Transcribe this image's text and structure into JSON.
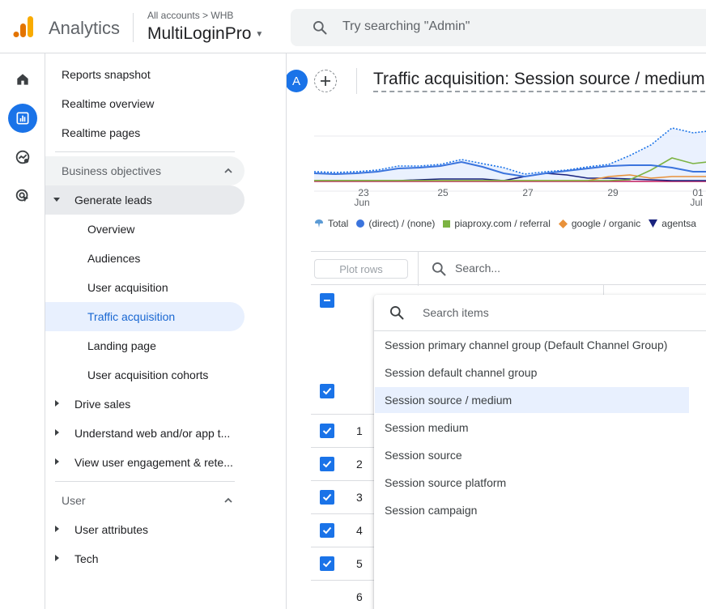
{
  "header": {
    "brand": "Analytics",
    "breadcrumb": "All accounts > WHB",
    "account_name": "MultiLoginPro",
    "search_placeholder": "Try searching \"Admin\""
  },
  "nav": {
    "reports_snapshot": "Reports snapshot",
    "realtime_overview": "Realtime overview",
    "realtime_pages": "Realtime pages",
    "business_objectives": "Business objectives",
    "generate_leads": "Generate leads",
    "overview": "Overview",
    "audiences": "Audiences",
    "user_acquisition": "User acquisition",
    "traffic_acquisition": "Traffic acquisition",
    "landing_page": "Landing page",
    "user_acquisition_cohorts": "User acquisition cohorts",
    "drive_sales": "Drive sales",
    "understand_web": "Understand web and/or app t...",
    "view_engagement": "View user engagement & rete...",
    "user_section": "User",
    "user_attributes": "User attributes",
    "tech": "Tech"
  },
  "report": {
    "avatar_letter": "A",
    "title": "Traffic acquisition: Session source / medium"
  },
  "chart_data": {
    "type": "line",
    "x_ticks": [
      {
        "day": "23",
        "month": "Jun"
      },
      {
        "day": "25",
        "month": ""
      },
      {
        "day": "27",
        "month": ""
      },
      {
        "day": "29",
        "month": ""
      },
      {
        "day": "01",
        "month": "Jul"
      }
    ],
    "legend": [
      "Total",
      "(direct) / (none)",
      "piaproxy.com / referral",
      "google / organic",
      "agentsa"
    ],
    "colors": {
      "total": "#1a73e8",
      "direct": "#3b74dd",
      "piaproxy": "#7cb342",
      "google": "#e8913a",
      "agents": "#1a237e",
      "magenta": "#c2185b"
    }
  },
  "table": {
    "plot_rows": "Plot rows",
    "search_placeholder": "Search...",
    "rows": [
      "1",
      "2",
      "3",
      "4",
      "5",
      "6"
    ]
  },
  "dropdown": {
    "search_placeholder": "Search items",
    "options": [
      "Session primary channel group (Default Channel Group)",
      "Session default channel group",
      "Session source / medium",
      "Session medium",
      "Session source",
      "Session source platform",
      "Session campaign"
    ]
  }
}
